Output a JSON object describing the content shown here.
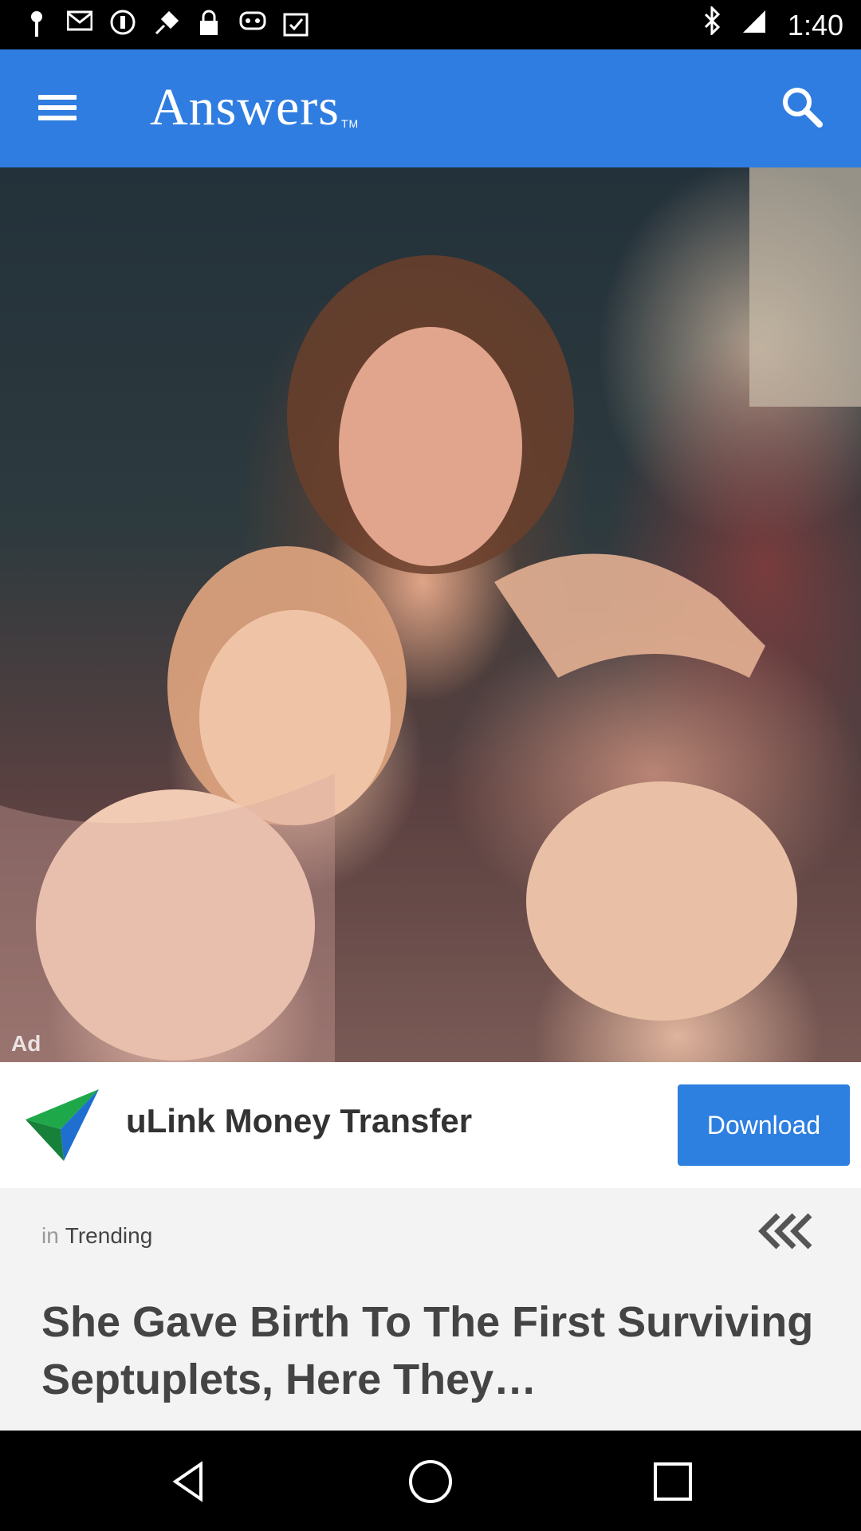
{
  "status_bar": {
    "time": "1:40",
    "icons": [
      "location-pin-icon",
      "gmail-icon",
      "do-not-disturb-icon",
      "fake-gps-icon",
      "lock-icon",
      "game-controller-icon",
      "clipboard-check-icon"
    ],
    "right_icons": [
      "bluetooth-icon",
      "signal-icon"
    ]
  },
  "app_bar": {
    "title": "Answers",
    "trademark": "TM",
    "color": "#2f7de0"
  },
  "hero": {
    "ad_label": "Ad"
  },
  "ad": {
    "title": "uLink Money Transfer",
    "button_label": "Download",
    "button_color": "#2d7fe0"
  },
  "article": {
    "category_prefix": "in",
    "category": "Trending",
    "headline": "She Gave Birth To The First Surviving Septuplets, Here They…"
  },
  "nav_bar": {
    "buttons": [
      "back-icon",
      "home-icon",
      "recents-icon"
    ]
  }
}
